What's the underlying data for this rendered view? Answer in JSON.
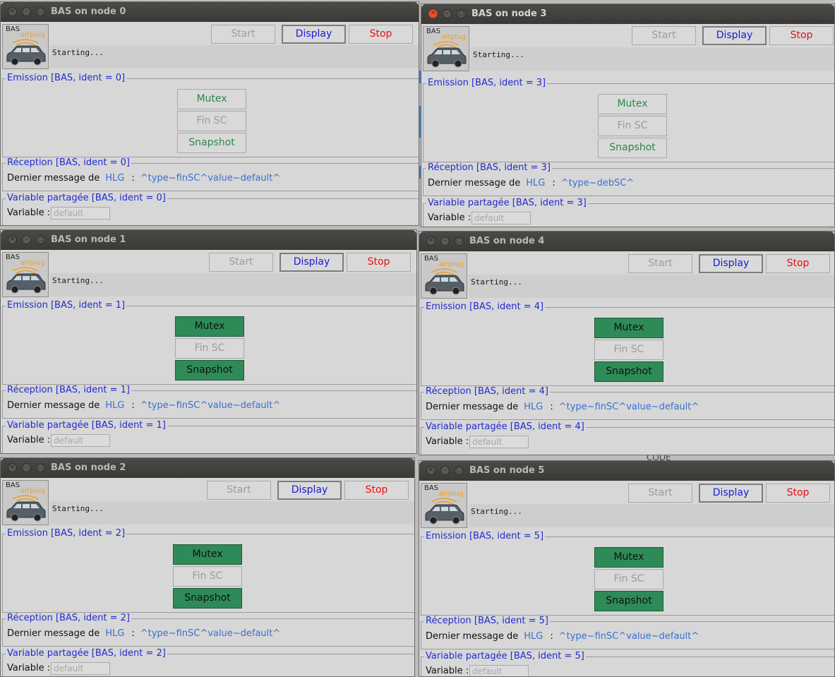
{
  "windows": [
    {
      "title": "BAS on node 0",
      "active": false,
      "status": "Starting...",
      "logo_bas": "BAS",
      "logo_airplug": "airplug",
      "buttons": {
        "start": "Start",
        "display": "Display",
        "stop": "Stop"
      },
      "emission": {
        "label": "Emission [BAS, ident = 0]",
        "mutex": "Mutex",
        "fin_sc": "Fin SC",
        "snapshot": "Snapshot",
        "state": "normal"
      },
      "reception": {
        "label": "Réception [BAS, ident = 0]",
        "prefix": "Dernier message de",
        "from": "HLG",
        "colon": ":",
        "msg": "^type~finSC^value~default^"
      },
      "variable": {
        "label": "Variable partagée [BAS, ident = 0]",
        "name": "Variable :",
        "value": "default"
      }
    },
    {
      "title": "BAS on node 3",
      "active": true,
      "status": "Starting...",
      "logo_bas": "BAS",
      "logo_airplug": "airplug",
      "buttons": {
        "start": "Start",
        "display": "Display",
        "stop": "Stop"
      },
      "emission": {
        "label": "Emission [BAS, ident = 3]",
        "mutex": "Mutex",
        "fin_sc": "Fin SC",
        "snapshot": "Snapshot",
        "state": "normal"
      },
      "reception": {
        "label": "Réception [BAS, ident = 3]",
        "prefix": "Dernier message de",
        "from": "HLG",
        "colon": ":",
        "msg": "^type~debSC^"
      },
      "variable": {
        "label": "Variable partagée [BAS, ident = 3]",
        "name": "Variable :",
        "value": "default"
      }
    },
    {
      "title": "BAS on node 1",
      "active": false,
      "status": "Starting...",
      "logo_bas": "BAS",
      "logo_airplug": "airplug",
      "buttons": {
        "start": "Start",
        "display": "Display",
        "stop": "Stop"
      },
      "emission": {
        "label": "Emission [BAS, ident = 1]",
        "mutex": "Mutex",
        "fin_sc": "Fin SC",
        "snapshot": "Snapshot",
        "state": "active"
      },
      "reception": {
        "label": "Réception [BAS, ident = 1]",
        "prefix": "Dernier message de",
        "from": "HLG",
        "colon": ":",
        "msg": "^type~finSC^value~default^"
      },
      "variable": {
        "label": "Variable partagée [BAS, ident = 1]",
        "name": "Variable :",
        "value": "default"
      }
    },
    {
      "title": "BAS on node 4",
      "active": false,
      "status": "Starting...",
      "logo_bas": "BAS",
      "logo_airplug": "airplug",
      "buttons": {
        "start": "Start",
        "display": "Display",
        "stop": "Stop"
      },
      "emission": {
        "label": "Emission [BAS, ident = 4]",
        "mutex": "Mutex",
        "fin_sc": "Fin SC",
        "snapshot": "Snapshot",
        "state": "active"
      },
      "reception": {
        "label": "Réception [BAS, ident = 4]",
        "prefix": "Dernier message de",
        "from": "HLG",
        "colon": ":",
        "msg": "^type~finSC^value~default^"
      },
      "variable": {
        "label": "Variable partagée [BAS, ident = 4]",
        "name": "Variable :",
        "value": "default"
      }
    },
    {
      "title": "BAS on node 2",
      "active": false,
      "status": "Starting...",
      "logo_bas": "BAS",
      "logo_airplug": "airplug",
      "buttons": {
        "start": "Start",
        "display": "Display",
        "stop": "Stop"
      },
      "emission": {
        "label": "Emission [BAS, ident = 2]",
        "mutex": "Mutex",
        "fin_sc": "Fin SC",
        "snapshot": "Snapshot",
        "state": "active"
      },
      "reception": {
        "label": "Réception [BAS, ident = 2]",
        "prefix": "Dernier message de",
        "from": "HLG",
        "colon": ":",
        "msg": "^type~finSC^value~default^"
      },
      "variable": {
        "label": "Variable partagée [BAS, ident = 2]",
        "name": "Variable :",
        "value": "default"
      }
    },
    {
      "title": "BAS on node 5",
      "active": false,
      "status": "Starting...",
      "logo_bas": "BAS",
      "logo_airplug": "airplug",
      "buttons": {
        "start": "Start",
        "display": "Display",
        "stop": "Stop"
      },
      "emission": {
        "label": "Emission [BAS, ident = 5]",
        "mutex": "Mutex",
        "fin_sc": "Fin SC",
        "snapshot": "Snapshot",
        "state": "active"
      },
      "reception": {
        "label": "Réception [BAS, ident = 5]",
        "prefix": "Dernier message de",
        "from": "HLG",
        "colon": ":",
        "msg": "^type~finSC^value~default^"
      },
      "variable": {
        "label": "Variable partagée [BAS, ident = 5]",
        "name": "Variable :",
        "value": "default"
      }
    }
  ],
  "background_text": "CODE",
  "colors": {
    "section_label": "#1f2bd0",
    "display_text": "#1b1bd6",
    "stop_text": "#e81010",
    "active_button": "#2e8b57",
    "link_text": "#3a6fd0",
    "close_active": "#e8552f",
    "airplug_text": "#f0a020"
  }
}
